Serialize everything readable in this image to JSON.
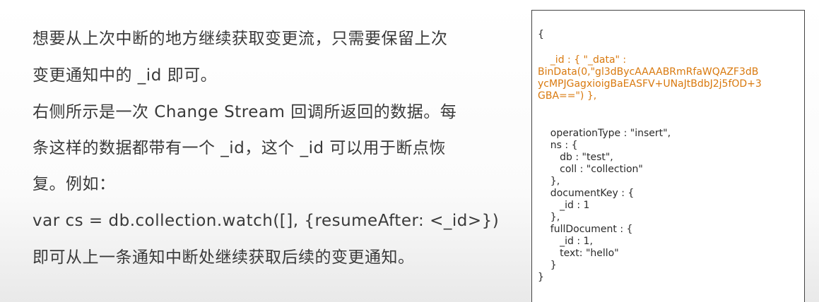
{
  "left_text": {
    "l1": "想要从上次中断的地方继续获取变更流，只需要保留上次",
    "l2": "变更通知中的 _id 即可。",
    "l3": "右侧所示是一次 Change Stream 回调所返回的数据。每",
    "l4": "条这样的数据都带有一个 _id，这个 _id 可以用于断点恢",
    "l5": "复。例如：",
    "l6": "var cs = db.collection.watch([], {resumeAfter: <_id>})",
    "l7": "即可从上一条通知中断处继续获取后续的变更通知。"
  },
  "code": {
    "open": "{",
    "id_1": "    _id : { \"_data\" :",
    "id_2": "BinData(0,\"gl3dBycAAAABRmRfaWQAZF3dB",
    "id_3": "ycMPJGagxioigBaEASFV+UNaJtBdbJ2j5fOD+3",
    "id_4": "GBA==\") },",
    "op": "    operationType : \"insert\",",
    "ns_open": "    ns : {",
    "db": "       db : \"test\",",
    "coll": "       coll : \"collection\"",
    "ns_close": "    },",
    "dk_open": "    documentKey : {",
    "dk_id": "       _id : 1",
    "dk_close": "    },",
    "fd_open": "    fullDocument : {",
    "fd_id": "       _id : 1,",
    "fd_text": "       text: \"hello\"",
    "fd_close": "    }",
    "close": "}"
  },
  "colors": {
    "text": "#3a3a3a",
    "highlight": "#d9790e",
    "border": "#444444"
  }
}
